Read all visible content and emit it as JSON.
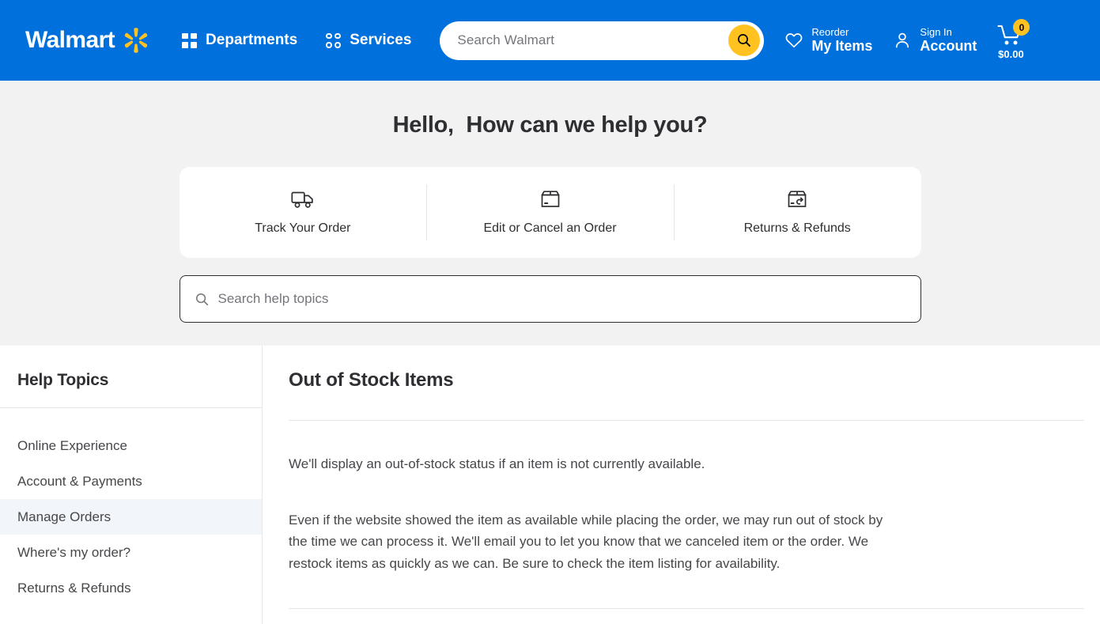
{
  "colors": {
    "brand_blue": "#0071dc",
    "brand_yellow": "#ffc220",
    "hero_bg": "#f2f2f2",
    "active_topic_bg": "#f2f5fa",
    "text_dark": "#2e2f32",
    "text_body": "#46474a",
    "placeholder": "#74767c"
  },
  "header": {
    "brand_name": "Walmart",
    "spark_icon": "walmart-spark-icon",
    "departments": {
      "label": "Departments",
      "icon": "grid-squares-icon"
    },
    "services": {
      "label": "Services",
      "icon": "grid-circles-icon"
    },
    "search": {
      "placeholder": "Search Walmart",
      "value": "",
      "button_icon": "search-icon"
    },
    "reorder": {
      "small": "Reorder",
      "big": "My Items",
      "icon": "heart-icon"
    },
    "account": {
      "small": "Sign In",
      "big": "Account",
      "icon": "person-icon"
    },
    "cart": {
      "icon": "cart-icon",
      "badge_count": "0",
      "total": "$0.00"
    }
  },
  "hero": {
    "title": "Hello,  How can we help you?",
    "cards": [
      {
        "label": "Track Your Order",
        "icon": "delivery-truck-icon"
      },
      {
        "label": "Edit or Cancel an Order",
        "icon": "box-icon"
      },
      {
        "label": "Returns & Refunds",
        "icon": "box-return-icon"
      }
    ],
    "help_search": {
      "placeholder": "Search help topics",
      "value": "",
      "icon": "search-icon"
    }
  },
  "sidebar": {
    "title": "Help Topics",
    "items": [
      {
        "label": "Online Experience",
        "active": false
      },
      {
        "label": "Account & Payments",
        "active": false
      },
      {
        "label": "Manage Orders",
        "active": true
      },
      {
        "label": "Where's my order?",
        "active": false
      },
      {
        "label": "Returns & Refunds",
        "active": false
      }
    ]
  },
  "content": {
    "title": "Out of Stock Items",
    "paragraph_1": "We'll display an out-of-stock status if an item is not currently available.",
    "paragraph_2": "Even if the website showed the item as available while placing the order, we may run out of stock by the time we can process it. We'll email you to let you know that we canceled item or the order. We restock items as quickly as we can. Be sure to check the item listing for availability."
  }
}
